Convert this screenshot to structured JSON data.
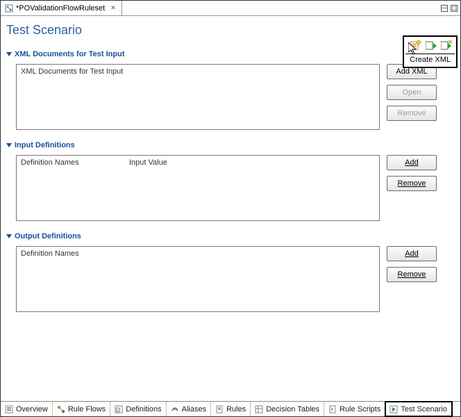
{
  "tab": {
    "title": "*POValidationFlowRuleset",
    "close_glyph": "✕"
  },
  "window_controls": {
    "min": "—",
    "max": "▢"
  },
  "editor_title": "Test Scenario",
  "toolbar": {
    "tooltip": "Create XML"
  },
  "sections": {
    "xml_docs": {
      "title": "XML Documents for Test Input",
      "list_header": "XML Documents for Test Input",
      "buttons": {
        "add": "Add XML",
        "open": "Open",
        "remove": "Remove"
      }
    },
    "input_defs": {
      "title": "Input Definitions",
      "col1": "Definition Names",
      "col2": "Input Value",
      "buttons": {
        "add": "Add",
        "remove": "Remove"
      }
    },
    "output_defs": {
      "title": "Output Definitions",
      "col1": "Definition Names",
      "buttons": {
        "add": "Add",
        "remove": "Remove"
      }
    }
  },
  "bottom_tabs": [
    {
      "label": "Overview"
    },
    {
      "label": "Rule Flows"
    },
    {
      "label": "Definitions"
    },
    {
      "label": "Aliases"
    },
    {
      "label": "Rules"
    },
    {
      "label": "Decision Tables"
    },
    {
      "label": "Rule Scripts"
    },
    {
      "label": "Test Scenario"
    }
  ]
}
